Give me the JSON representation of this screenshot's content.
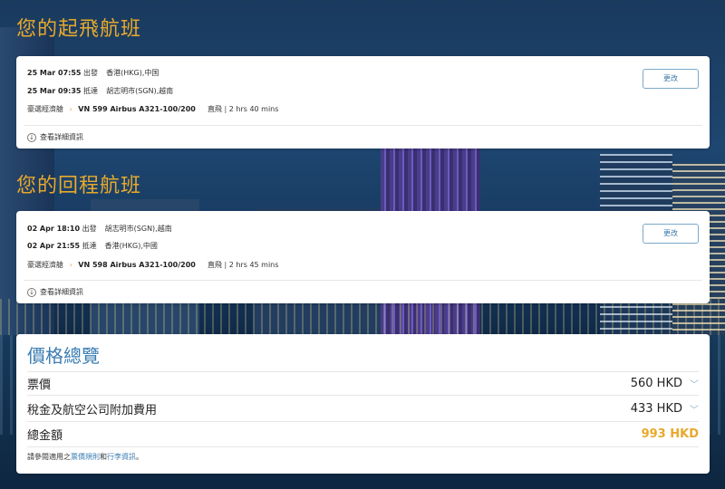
{
  "outbound": {
    "title": "您的起飛航班",
    "depart": {
      "datetime": "25 Mar 07:55",
      "action": "出發",
      "place": "香港(HKG),中国"
    },
    "arrive": {
      "datetime": "25 Mar 09:35",
      "action": "抵達",
      "place": "胡志明市(SGN),越南"
    },
    "cabin": "豪選經濟艙",
    "flight": "VN 599 Airbus A321-100/200",
    "stops": "直飛",
    "duration": "2 hrs 40 mins",
    "details_label": "查看詳細資訊",
    "change_label": "更改"
  },
  "inbound": {
    "title": "您的回程航班",
    "depart": {
      "datetime": "02 Apr 18:10",
      "action": "出發",
      "place": "胡志明市(SGN),越南"
    },
    "arrive": {
      "datetime": "02 Apr 21:55",
      "action": "抵達",
      "place": "香港(HKG),中國"
    },
    "cabin": "豪選經濟艙",
    "flight": "VN 598 Airbus A321-100/200",
    "stops": "直飛",
    "duration": "2 hrs 45 mins",
    "details_label": "查看詳細資訊",
    "change_label": "更改"
  },
  "price": {
    "title": "價格總覽",
    "fare_label": "票價",
    "fare_value": "560 HKD",
    "tax_label": "稅金及航空公司附加費用",
    "tax_value": "433 HKD",
    "total_label": "總金額",
    "total_value": "993 HKD",
    "note_prefix": "請參閱適用之",
    "fare_rules_link": "票價規則",
    "note_and": "和",
    "baggage_link": "行李資訊",
    "note_suffix": "。"
  },
  "colors": {
    "accent": "#e8a92b",
    "link": "#3b7db3"
  }
}
